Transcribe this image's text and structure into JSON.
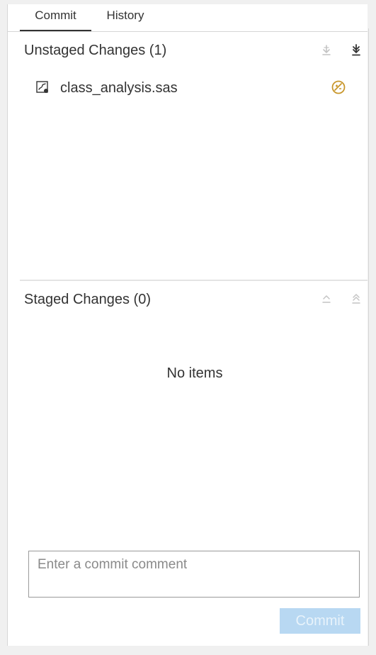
{
  "tabs": {
    "commit": "Commit",
    "history": "History"
  },
  "unstaged": {
    "title": "Unstaged Changes (1)",
    "stage_selected_icon": "stage-selected-icon",
    "stage_all_icon": "stage-all-icon",
    "files": [
      {
        "name": "class_analysis.sas",
        "file_icon": "sas-program-file-icon",
        "status_icon": "modified-status-icon"
      }
    ]
  },
  "staged": {
    "title": "Staged Changes (0)",
    "unstage_selected_icon": "unstage-selected-icon",
    "unstage_all_icon": "unstage-all-icon",
    "empty_text": "No items"
  },
  "commit_form": {
    "placeholder": "Enter a commit comment",
    "value": "",
    "button_label": "Commit"
  },
  "colors": {
    "status_icon": "#c8962a",
    "commit_button_disabled": "#b8d8f2",
    "muted_icon": "#b8b8b8",
    "active_icon": "#333333"
  }
}
